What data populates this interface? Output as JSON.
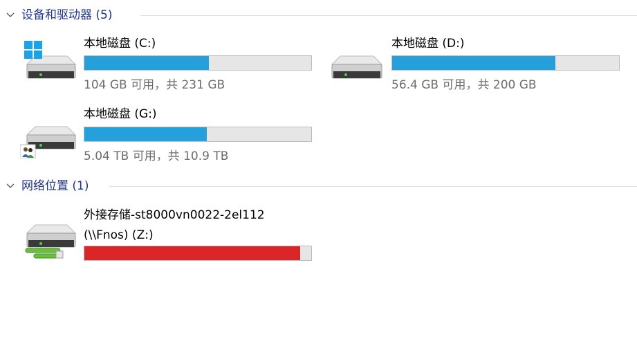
{
  "devices_group": {
    "title": "设备和驱动器 (5)"
  },
  "network_group": {
    "title": "网络位置 (1)"
  },
  "drives": [
    {
      "name": "本地磁盘 (C:)",
      "free_text": "104 GB 可用，共 231 GB",
      "used_fraction": 0.55,
      "icon": "windows-system-drive-icon"
    },
    {
      "name": "本地磁盘 (D:)",
      "free_text": "56.4 GB 可用，共 200 GB",
      "used_fraction": 0.72,
      "icon": "hard-drive-icon"
    },
    {
      "name": "本地磁盘 (G:)",
      "free_text": "5.04 TB 可用，共 10.9 TB",
      "used_fraction": 0.54,
      "icon": "shared-drive-icon"
    }
  ],
  "network_drives": [
    {
      "name_line1": "外接存储-st8000vn0022-2el112",
      "name_line2": "(\\\\Fnos) (Z:)",
      "used_fraction": 0.95,
      "bar_color": "#da2626",
      "icon": "network-drive-icon"
    }
  ],
  "colors": {
    "header_text": "#1e3287",
    "bar_fill": "#26a0da",
    "bar_full": "#da2626",
    "bar_track": "#e6e6e6",
    "secondary_text": "#6d6d6d"
  }
}
